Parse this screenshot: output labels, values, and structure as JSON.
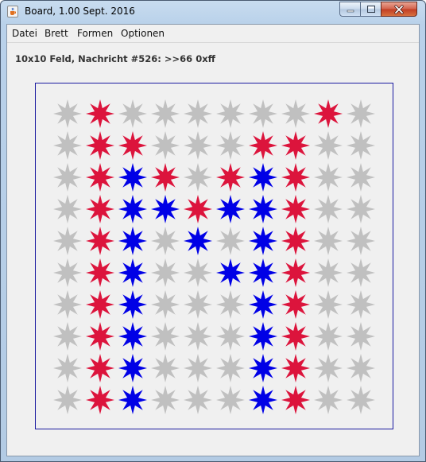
{
  "window": {
    "title": "Board, 1.00 Sept. 2016"
  },
  "menu": {
    "items": [
      "Datei",
      "Brett",
      "Formen",
      "Optionen"
    ]
  },
  "status": {
    "text": "10x10 Feld, Nachricht #526: >>66 0xff"
  },
  "board": {
    "rows": 10,
    "cols": 10,
    "shape": "8-point-star",
    "colors": {
      "g": "#c0c0c0",
      "r": "#dc143c",
      "b": "#0000e6"
    },
    "grid": [
      "grggggggrg",
      "grrgggrrgg",
      "grbrgrbrgg",
      "grbbrbbrgg",
      "grbgbgbrgg",
      "grbggbbrgg",
      "grbgggbrgg",
      "grbgggbrgg",
      "grbgggbrgg",
      "grbgggbrgg"
    ]
  }
}
